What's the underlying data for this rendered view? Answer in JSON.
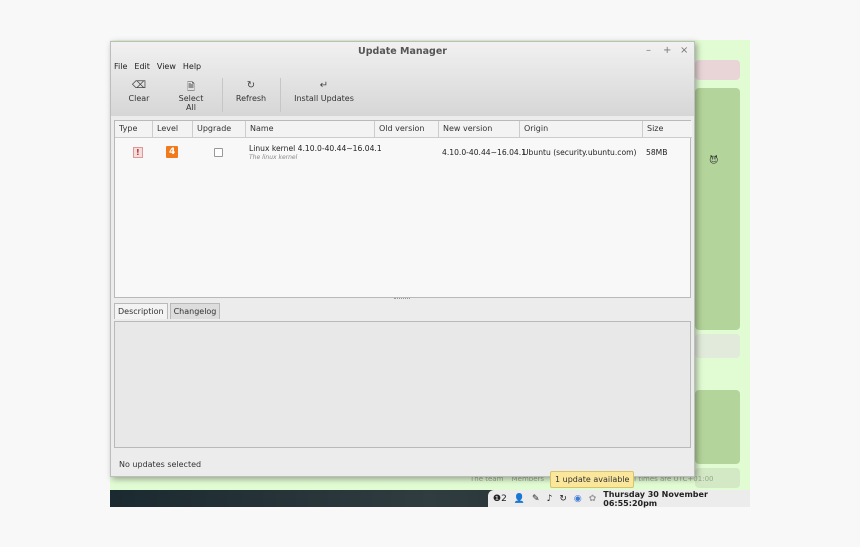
{
  "window": {
    "title": "Update Manager",
    "minimize": "–",
    "maximize": "+",
    "close": "×"
  },
  "menu": [
    "File",
    "Edit",
    "View",
    "Help"
  ],
  "toolbar": [
    {
      "label": "Clear",
      "icon": "clear-icon",
      "glyph": "⌫"
    },
    {
      "label": "Select All",
      "icon": "document-icon",
      "glyph": "🗎"
    },
    {
      "label": "Refresh",
      "icon": "refresh-icon",
      "glyph": "↻"
    },
    {
      "label": "Install Updates",
      "icon": "enter-icon",
      "glyph": "↵"
    }
  ],
  "columns": [
    "Type",
    "Level",
    "Upgrade",
    "Name",
    "Old version",
    "New version",
    "Origin",
    "Size"
  ],
  "rows": [
    {
      "type": "!",
      "level": "4",
      "upgrade": false,
      "name": "Linux kernel 4.10.0-40.44~16.04.1",
      "description": "The linux kernel",
      "old_version": "",
      "new_version": "4.10.0-40.44~16.04.1",
      "origin": "Ubuntu (security.ubuntu.com)",
      "size": "58MB"
    }
  ],
  "tabs": [
    "Description",
    "Changelog"
  ],
  "status": "No updates selected",
  "tooltip": "1 update available",
  "background_footer": {
    "team": "The team",
    "members": "Members",
    "tail": "ookies • All times are UTC+01:00"
  },
  "tray": {
    "notification_count": "2",
    "clock": "Thursday 30 November 06:55:20pm"
  },
  "colors": {
    "level_badge": "#f07a1c",
    "type_icon": "#cc2222",
    "web_green": "#b3d49a"
  }
}
